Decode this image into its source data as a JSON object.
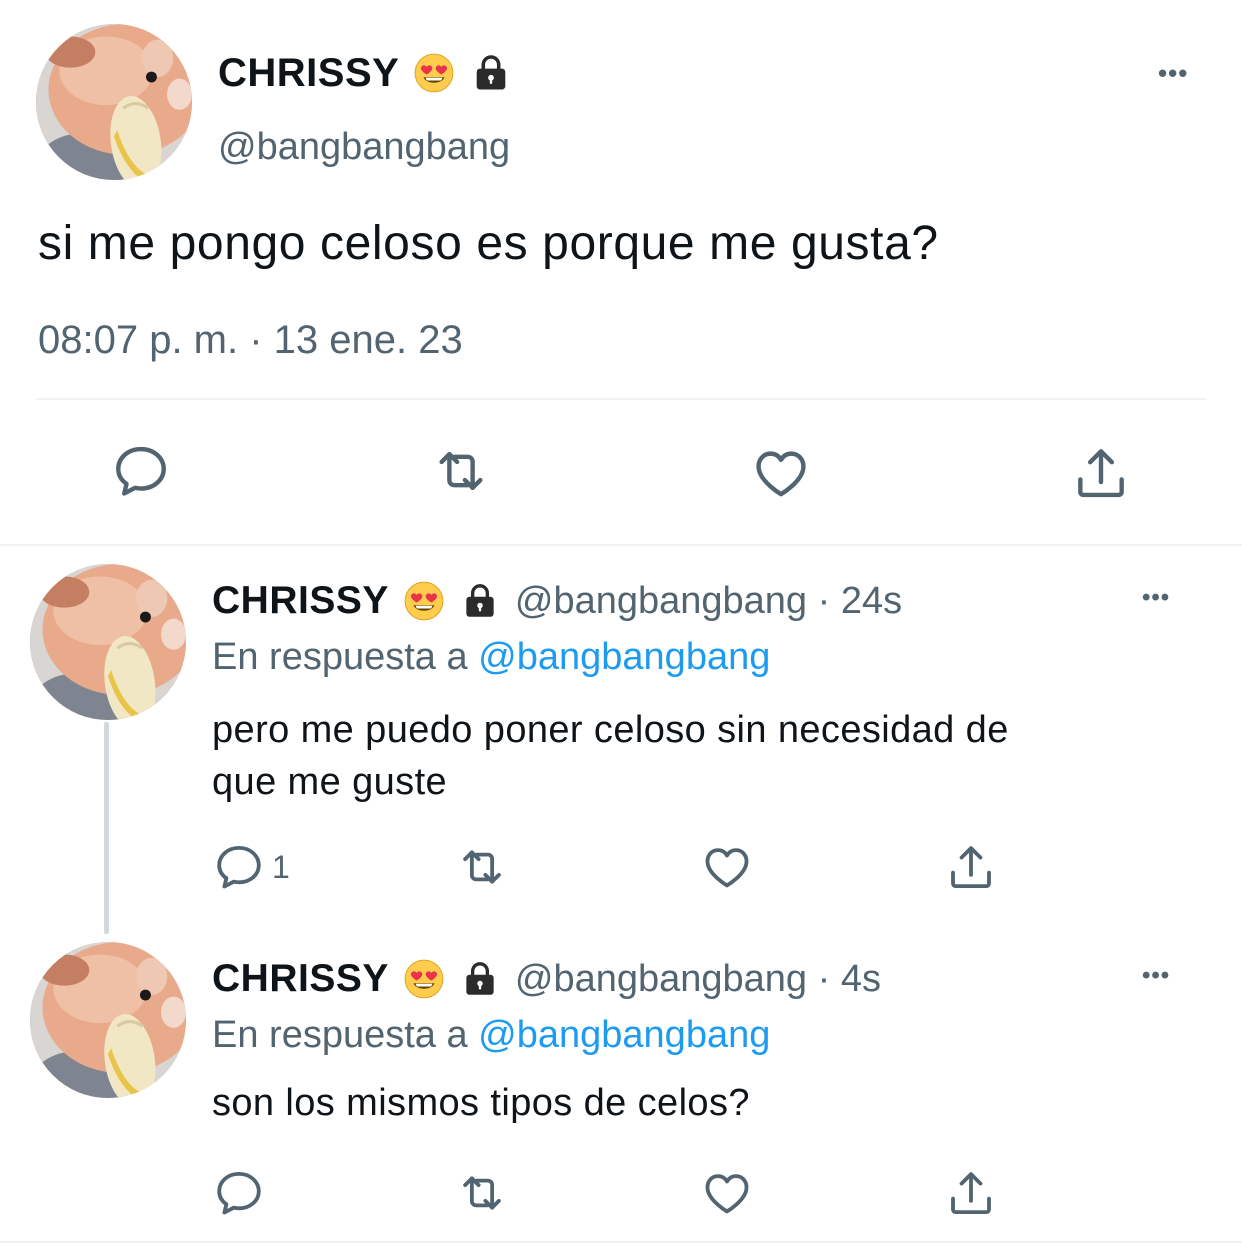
{
  "main_tweet": {
    "display_name": "CHRISSY",
    "handle": "@bangbangbang",
    "text": "si me pongo celoso es porque me gusta?",
    "timestamp": "08:07 p. m. · 13 ene. 23",
    "more": "•••"
  },
  "replies": [
    {
      "display_name": "CHRISSY",
      "handle_time": "@bangbangbang · 24s",
      "reply_prefix": "En respuesta a",
      "reply_to": "@bangbangbang",
      "text_line1": "pero me puedo poner celoso sin necesidad de",
      "text_line2": "que me guste",
      "reply_count": "1",
      "more": "•••"
    },
    {
      "display_name": "CHRISSY",
      "handle_time": "@bangbangbang · 4s",
      "reply_prefix": "En respuesta a",
      "reply_to": "@bangbangbang",
      "text_line1": "son los mismos tipos de celos?",
      "more": "•••"
    }
  ],
  "icons": [
    "heart-eyes-emoji-icon",
    "lock-icon",
    "reply-icon",
    "retweet-icon",
    "like-icon",
    "share-icon",
    "more-icon"
  ],
  "colors": {
    "text": "#0f1419",
    "muted": "#536471",
    "link": "#1d9bf0",
    "divider": "#eff3f4"
  }
}
